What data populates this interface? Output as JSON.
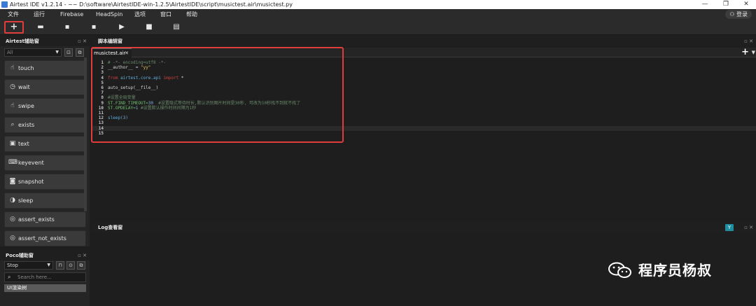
{
  "window": {
    "title": "Airtest IDE v1.2.14 - ~~ D:\\software\\AirtestIDE-win-1.2.5\\AirtestIDE\\script\\musictest.air\\musictest.py",
    "controls": {
      "minimize": "—",
      "maximize": "❐",
      "close": "✕"
    }
  },
  "menubar": {
    "items": [
      "文件",
      "运行",
      "Firebase",
      "HeadSpin",
      "选项",
      "窗口",
      "帮助"
    ],
    "login": "登录"
  },
  "toolbar": {
    "buttons": [
      {
        "name": "new-script",
        "glyph": "+"
      },
      {
        "name": "open-script",
        "glyph": "▬"
      },
      {
        "name": "save",
        "glyph": "▪"
      },
      {
        "name": "save-as",
        "glyph": "▪"
      },
      {
        "name": "run",
        "glyph": "▶"
      },
      {
        "name": "stop",
        "glyph": "■"
      },
      {
        "name": "report",
        "glyph": "▤"
      }
    ],
    "highlight_color": "#e03c3c"
  },
  "airtest_panel": {
    "title": "Airtest辅助窗",
    "filter_value": "All",
    "buttons": [
      {
        "label": "touch",
        "icon": "☝"
      },
      {
        "label": "wait",
        "icon": "◷"
      },
      {
        "label": "swipe",
        "icon": "☝"
      },
      {
        "label": "exists",
        "icon": "⌕"
      },
      {
        "label": "text",
        "icon": "▣"
      },
      {
        "label": "keyevent",
        "icon": "⌨"
      },
      {
        "label": "snapshot",
        "icon": "◙"
      },
      {
        "label": "sleep",
        "icon": "◑"
      },
      {
        "label": "assert_exists",
        "icon": "◎"
      },
      {
        "label": "assert_not_exists",
        "icon": "◎"
      }
    ]
  },
  "poco_panel": {
    "title": "Poco辅助窗",
    "selected_mode": "Stop",
    "search_placeholder": "Search here...",
    "tree_row": "UI渲染树"
  },
  "editor": {
    "title": "脚本编辑窗",
    "active_tab": "musictest.air",
    "lines": [
      {
        "n": "1",
        "tokens": [
          {
            "t": "# -*- encoding=utf8 -*-",
            "c": "cm"
          }
        ]
      },
      {
        "n": "2",
        "tokens": [
          {
            "t": "__author__ = ",
            "c": "def"
          },
          {
            "t": "\"yy\"",
            "c": "str"
          }
        ]
      },
      {
        "n": "3",
        "tokens": []
      },
      {
        "n": "4",
        "tokens": [
          {
            "t": "from ",
            "c": "kw"
          },
          {
            "t": "airtest.core.api ",
            "c": "fn"
          },
          {
            "t": "import ",
            "c": "kw"
          },
          {
            "t": "*",
            "c": "def"
          }
        ]
      },
      {
        "n": "5",
        "tokens": []
      },
      {
        "n": "6",
        "tokens": [
          {
            "t": "auto_setup(__file__)",
            "c": "def"
          }
        ]
      },
      {
        "n": "7",
        "tokens": []
      },
      {
        "n": "8",
        "tokens": [
          {
            "t": "#设置全局变量",
            "c": "cm"
          }
        ]
      },
      {
        "n": "9",
        "tokens": [
          {
            "t": "ST.FIND_TIMEOUT=",
            "c": "st"
          },
          {
            "t": "30",
            "c": "num"
          },
          {
            "t": "  #设置隐式等待时长,默认识别图片时间是30秒, 可改为10秒找不到就不找了",
            "c": "cm"
          }
        ]
      },
      {
        "n": "10",
        "tokens": [
          {
            "t": "ST.OPDELAY=",
            "c": "st"
          },
          {
            "t": "1",
            "c": "num"
          },
          {
            "t": " #设置默认操作时间间隔为1秒",
            "c": "cm"
          }
        ]
      },
      {
        "n": "11",
        "tokens": []
      },
      {
        "n": "12",
        "tokens": [
          {
            "t": "sleep(",
            "c": "fn"
          },
          {
            "t": "3",
            "c": "num"
          },
          {
            "t": ")",
            "c": "fn"
          }
        ]
      },
      {
        "n": "13",
        "tokens": []
      },
      {
        "n": "14",
        "tokens": []
      },
      {
        "n": "15",
        "tokens": []
      }
    ],
    "current_line": "14"
  },
  "log_panel": {
    "title": "Log查看窗",
    "filter_icon": "filter-icon"
  },
  "watermark": {
    "text": "程序员杨叔"
  },
  "colors": {
    "background": "#1e1e1e",
    "panel": "#252526",
    "highlight_border": "#e03c3c",
    "filter_button": "#1f8fa0"
  }
}
